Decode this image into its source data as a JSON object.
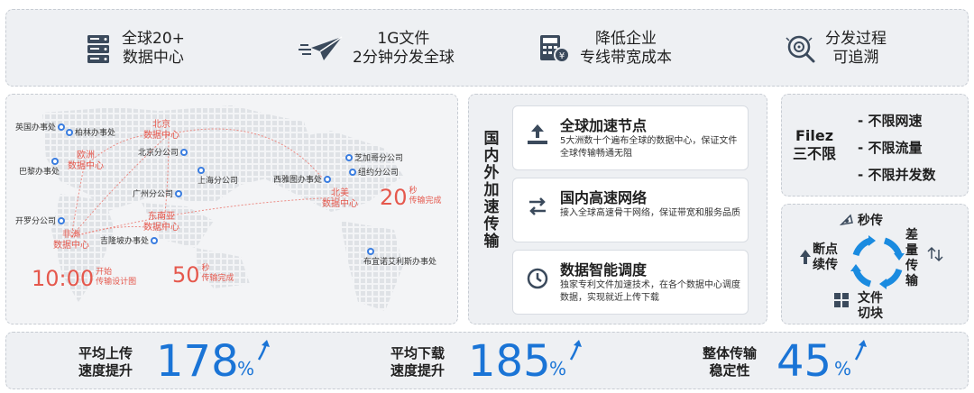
{
  "top_features": [
    {
      "icon": "server-icon",
      "line1": "全球20+",
      "line2": "数据中心"
    },
    {
      "icon": "paper-plane-icon",
      "line1": "1G文件",
      "line2": "2分钟分发全球"
    },
    {
      "icon": "calculator-cost-icon",
      "line1": "降低企业",
      "line2": "专线带宽成本"
    },
    {
      "icon": "trace-search-icon",
      "line1": "分发过程",
      "line2": "可追溯"
    }
  ],
  "map": {
    "offices": [
      "英国办事处",
      "柏林办事处",
      "巴黎办事处",
      "北京分公司",
      "上海分公司",
      "广州分公司",
      "开罗分公司",
      "吉隆坡办事处",
      "西雅图办事处",
      "芝加哥分公司",
      "纽约分公司",
      "布宜诺艾利斯办事处"
    ],
    "hubs": [
      {
        "line1": "北京",
        "line2": "数据中心"
      },
      {
        "line1": "欧洲",
        "line2": "数据中心"
      },
      {
        "line1": "东南亚",
        "line2": "数据中心"
      },
      {
        "line1": "非洲",
        "line2": "数据中心"
      },
      {
        "line1": "北美",
        "line2": "数据中心"
      }
    ],
    "timers": [
      {
        "value": "10:00",
        "line1": "开始",
        "line2": "传输设计图"
      },
      {
        "value": "50",
        "line1": "秒",
        "line2": "传输完成"
      },
      {
        "value": "20",
        "line1": "秒",
        "line2": "传输完成"
      }
    ]
  },
  "network": {
    "vertical_title": "国内外加速传输",
    "cards": [
      {
        "icon": "upload-node-icon",
        "title": "全球加速节点",
        "desc": "5大洲数十个遍布全球的数据中心，保证文件全球传输畅通无阻"
      },
      {
        "icon": "swap-arrows-icon",
        "title": "国内高速网络",
        "desc": "接入全球高速骨干网络，保证带宽和服务品质"
      },
      {
        "icon": "clock-schedule-icon",
        "title": "数据智能调度",
        "desc": "独家专利文件加速技术，在各个数据中心调度数据，实现就近上传下载"
      }
    ]
  },
  "filez": {
    "name_line1": "Filez",
    "name_line2": "三不限",
    "items": [
      "- 不限网速",
      "- 不限流量",
      "- 不限并发数"
    ]
  },
  "cycle": {
    "labels": {
      "instant": "秒传",
      "delta_l1": "差",
      "delta_l2": "量",
      "delta_l3": "传",
      "delta_l4": "输",
      "chunk_l1": "文件",
      "chunk_l2": "切块",
      "resume_l1": "断点",
      "resume_l2": "续传"
    }
  },
  "stats": [
    {
      "line1": "平均上传",
      "line2": "速度提升",
      "value": "178",
      "unit": "%"
    },
    {
      "line1": "平均下载",
      "line2": "速度提升",
      "value": "185",
      "unit": "%"
    },
    {
      "line1": "整体传输",
      "line2": "稳定性",
      "value": "45",
      "unit": "%"
    }
  ],
  "colors": {
    "accent_blue": "#1a74d6",
    "accent_red": "#e5584d",
    "panel_bg": "#eef0f3"
  }
}
